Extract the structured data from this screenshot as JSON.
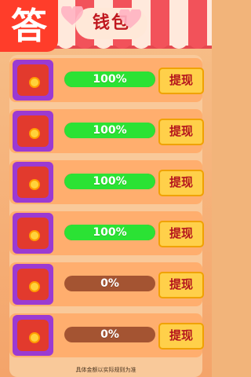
{
  "logo_text": "答",
  "title": "钱包",
  "rows": [
    {
      "progress": 100,
      "progress_label": "100%",
      "button_label": "提现"
    },
    {
      "progress": 100,
      "progress_label": "100%",
      "button_label": "提现"
    },
    {
      "progress": 100,
      "progress_label": "100%",
      "button_label": "提现"
    },
    {
      "progress": 100,
      "progress_label": "100%",
      "button_label": "提现"
    },
    {
      "progress": 0,
      "progress_label": "0%",
      "button_label": "提现"
    },
    {
      "progress": 0,
      "progress_label": "0%",
      "button_label": "提现"
    }
  ],
  "footer_note": "具体金额以实际规则为准",
  "colors": {
    "progress_fill": "#2be234",
    "progress_track": "#a45432",
    "button_bg": "#ffd04a",
    "button_text": "#b3121d",
    "icon_frame": "#9b3ad2",
    "envelope": "#e23a2d",
    "accent_red": "#ff3d2a"
  }
}
